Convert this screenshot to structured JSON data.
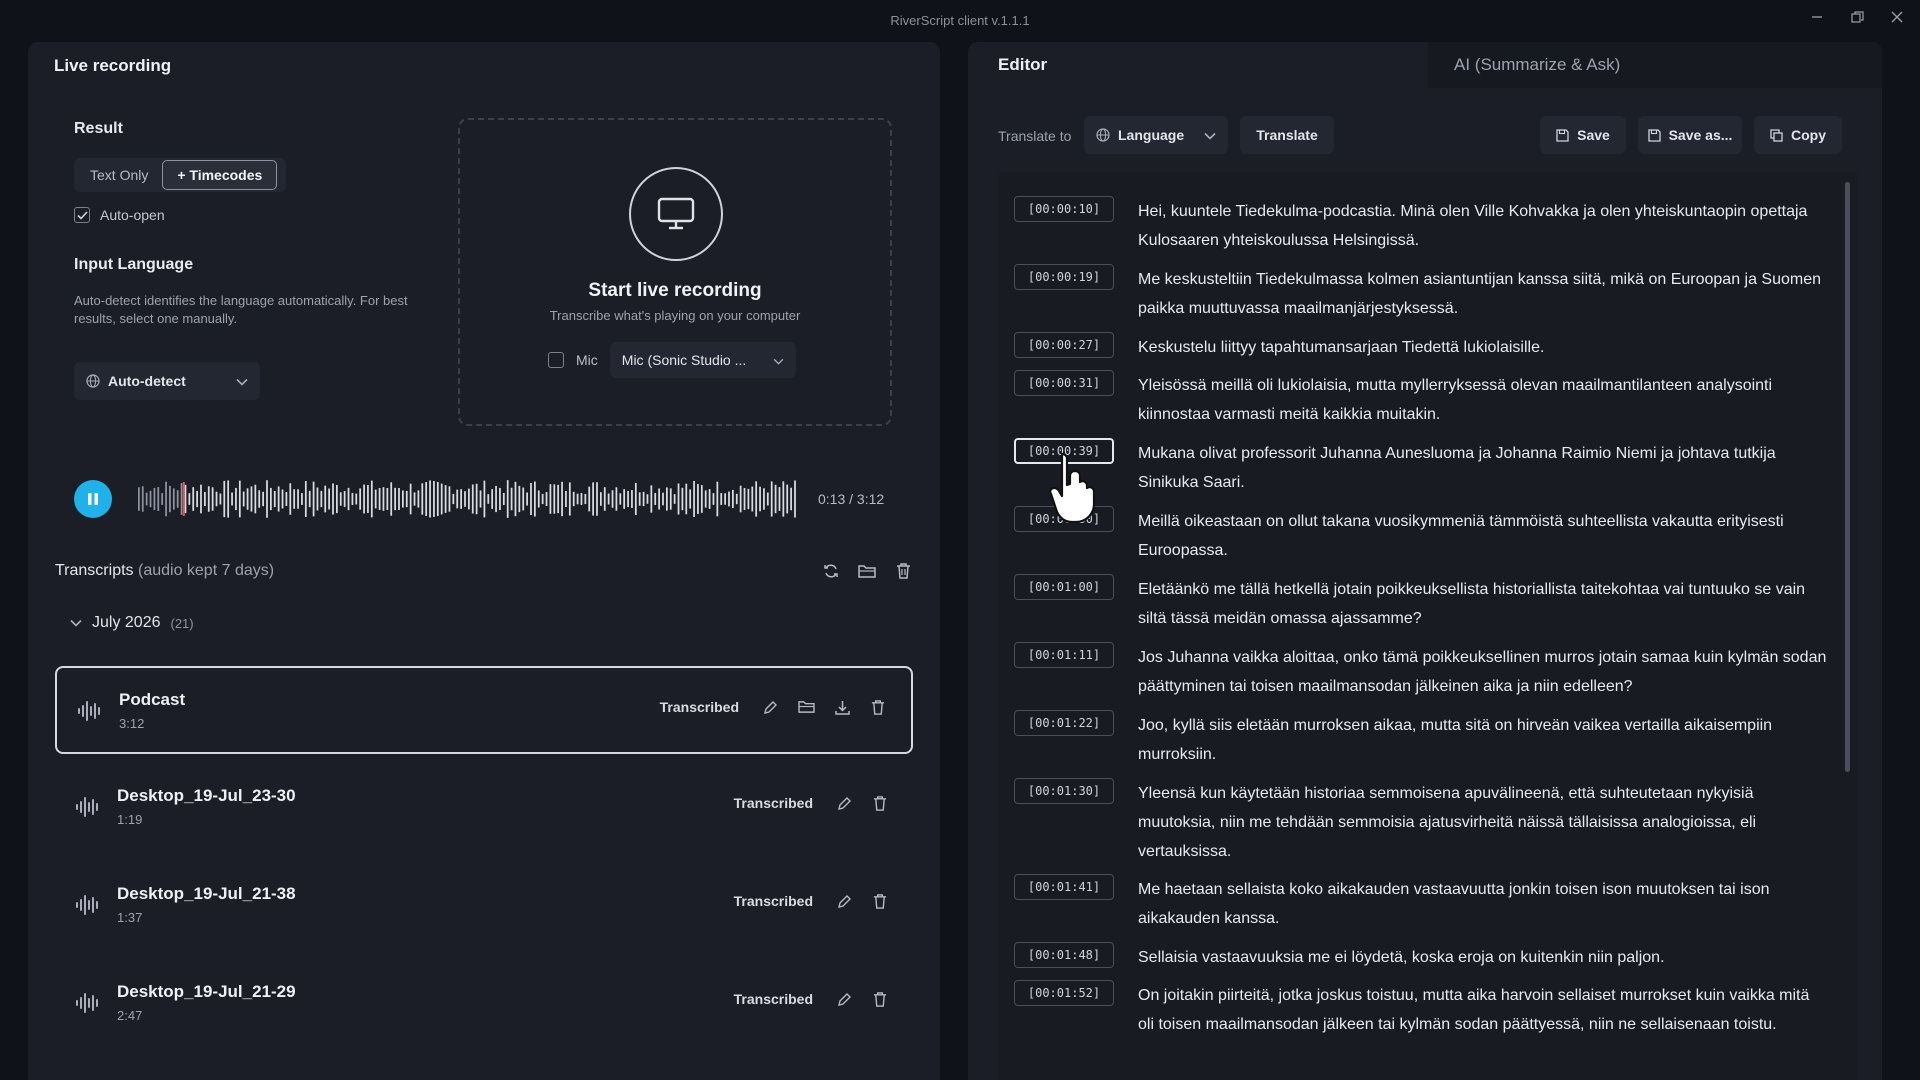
{
  "window": {
    "title": "RiverScript client v.1.1.1"
  },
  "left": {
    "title": "Live recording",
    "result": {
      "label": "Result",
      "options": [
        "Text Only",
        "+ Timecodes"
      ],
      "selected": "+ Timecodes",
      "auto_open_label": "Auto-open",
      "auto_open_checked": true
    },
    "input_language": {
      "label": "Input Language",
      "description": "Auto-detect identifies the language automatically. For best results, select one manually.",
      "value": "Auto-detect"
    },
    "live": {
      "title": "Start live recording",
      "subtitle": "Transcribe what's playing on your computer",
      "mic_label": "Mic",
      "mic_checked": false,
      "mic_device": "Mic (Sonic Studio ..."
    },
    "player": {
      "time": "0:13 / 3:12",
      "progress": 0.068,
      "state": "playing"
    },
    "transcripts": {
      "title": "Transcripts",
      "note": "(audio kept 7 days)",
      "group": {
        "label": "July 2026",
        "count": "(21)"
      },
      "items": [
        {
          "name": "Podcast",
          "duration": "3:12",
          "status": "Transcribed",
          "selected": true
        },
        {
          "name": "Desktop_19-Jul_23-30",
          "duration": "1:19",
          "status": "Transcribed",
          "selected": false
        },
        {
          "name": "Desktop_19-Jul_21-38",
          "duration": "1:37",
          "status": "Transcribed",
          "selected": false
        },
        {
          "name": "Desktop_19-Jul_21-29",
          "duration": "2:47",
          "status": "Transcribed",
          "selected": false
        }
      ]
    }
  },
  "right": {
    "tabs": [
      "Editor",
      "AI (Summarize & Ask)"
    ],
    "active_tab": "Editor",
    "toolbar": {
      "translate_label": "Translate to",
      "language_value": "Language",
      "translate_button": "Translate",
      "save_button": "Save",
      "save_as_button": "Save as...",
      "copy_button": "Copy"
    },
    "lines": [
      {
        "tc": "[00:00:10]",
        "text": "Hei, kuuntele Tiedekulma-podcastia. Minä olen Ville Kohvakka ja olen yhteiskuntaopin opettaja Kulosaaren yhteiskoulussa Helsingissä."
      },
      {
        "tc": "[00:00:19]",
        "text": "Me keskusteltiin Tiedekulmassa kolmen asiantuntijan kanssa siitä, mikä on Euroopan ja Suomen paikka muuttuvassa maailmanjärjestyksessä."
      },
      {
        "tc": "[00:00:27]",
        "text": "Keskustelu liittyy tapahtumansarjaan Tiedettä lukiolaisille."
      },
      {
        "tc": "[00:00:31]",
        "text": "Yleisössä meillä oli lukiolaisia, mutta myllerryksessä olevan maailmantilanteen analysointi kiinnostaa varmasti meitä kaikkia muitakin."
      },
      {
        "tc": "[00:00:39]",
        "text": "Mukana olivat professorit Juhanna Aunesluoma ja Johanna Raimio Niemi ja johtava tutkija Sinikuka Saari."
      },
      {
        "tc": "[00:00:50]",
        "text": "Meillä oikeastaan on ollut takana vuosikymmeniä tämmöistä suhteellista vakautta erityisesti Euroopassa."
      },
      {
        "tc": "[00:01:00]",
        "text": "Eletäänkö me tällä hetkellä jotain poikkeuksellista historiallista taitekohtaa vai tuntuuko se vain siltä tässä meidän omassa ajassamme?"
      },
      {
        "tc": "[00:01:11]",
        "text": "Jos Juhanna vaikka aloittaa, onko tämä poikkeuksellinen murros jotain samaa kuin kylmän sodan päättyminen tai toisen maailmansodan jälkeinen aika ja niin edelleen?"
      },
      {
        "tc": "[00:01:22]",
        "text": "Joo, kyllä siis eletään murroksen aikaa, mutta sitä on hirveän vaikea vertailla aikaisempiin murroksiin."
      },
      {
        "tc": "[00:01:30]",
        "text": "Yleensä kun käytetään historiaa semmoisena apuvälineenä, että suhteutetaan nykyisiä muutoksia, niin me tehdään semmoisia ajatusvirheitä näissä tällaisissa analogioissa, eli vertauksissa."
      },
      {
        "tc": "[00:01:41]",
        "text": "Me haetaan sellaista koko aikakauden vastaavuutta jonkin toisen ison muutoksen tai ison aikakauden kanssa."
      },
      {
        "tc": "[00:01:48]",
        "text": "Sellaisia vastaavuuksia me ei löydetä, koska eroja on kuitenkin niin paljon."
      },
      {
        "tc": "[00:01:52]",
        "text": "On joitakin piirteitä, jotka joskus toistuu, mutta aika harvoin sellaiset murrokset kuin vaikka mitä oli toisen maailmansodan jälkeen tai kylmän sodan päättyessä, niin ne sellaisenaan toistu."
      }
    ],
    "focused_line": 4
  },
  "colors": {
    "accent": "#1fb2ea",
    "panel": "#1b1e26",
    "background": "#0f1219"
  }
}
